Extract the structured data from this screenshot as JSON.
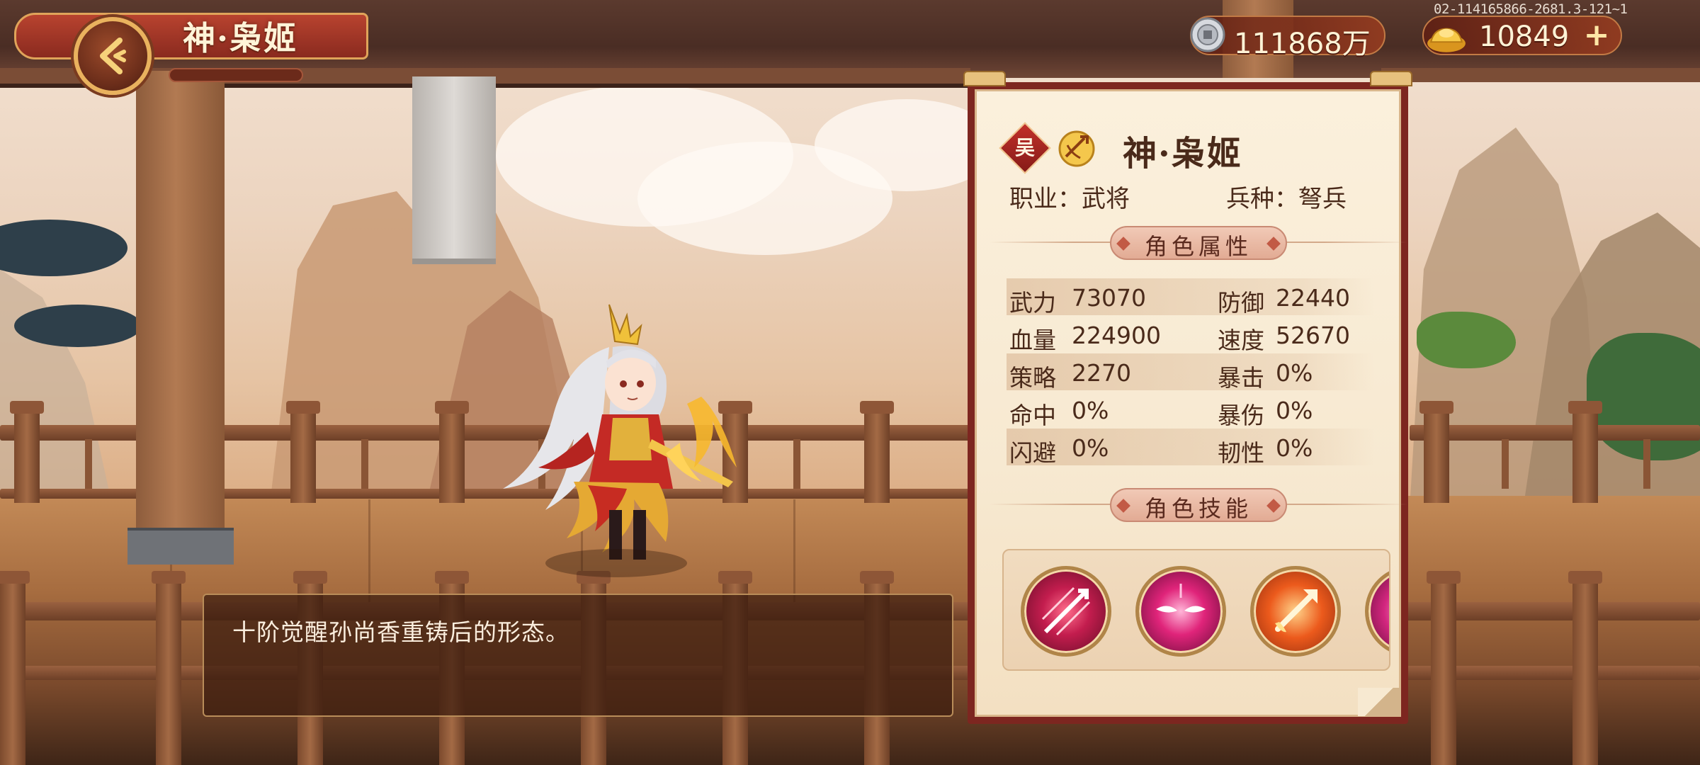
{
  "header": {
    "title": "神·枭姬",
    "back_icon": "back-arrow-icon"
  },
  "currencies": {
    "silver": {
      "icon": "silver-coin-icon",
      "value": "111868万"
    },
    "gold": {
      "icon": "gold-ingot-icon",
      "value": "10849",
      "add_label": "+"
    }
  },
  "build_id": "02-114165866-2681.3-121~1",
  "description": "十阶觉醒孙尚香重铸后的形态。",
  "hero": {
    "faction": "吴",
    "faction_color": "#b8282a",
    "class_icon": "crossbow-class-icon",
    "name": "神·枭姬",
    "profession": "职业：武将",
    "unit_type": "兵种：弩兵"
  },
  "attributes_title": "角色属性",
  "attributes": [
    {
      "label1": "武力",
      "value1": "73070",
      "label2": "防御",
      "value2": "22440"
    },
    {
      "label1": "血量",
      "value1": "224900",
      "label2": "速度",
      "value2": "52670"
    },
    {
      "label1": "策略",
      "value1": "2270",
      "label2": "暴击",
      "value2": "0%"
    },
    {
      "label1": "命中",
      "value1": "0%",
      "label2": "暴伤",
      "value2": "0%"
    },
    {
      "label1": "闪避",
      "value1": "0%",
      "label2": "韧性",
      "value2": "0%"
    }
  ],
  "skills_title": "角色技能",
  "skills": [
    {
      "icon": "arrow-volley-skill-icon"
    },
    {
      "icon": "glaring-eyes-skill-icon"
    },
    {
      "icon": "flaming-arrow-skill-icon"
    },
    {
      "icon": "pink-burst-skill-icon"
    }
  ]
}
